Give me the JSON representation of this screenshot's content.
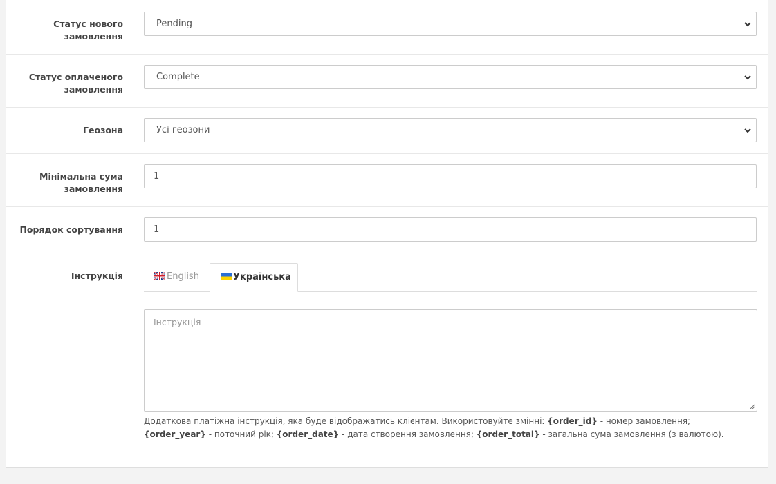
{
  "form": {
    "new_order_status": {
      "label_line1": "Статус нового",
      "label_line2": "замовлення",
      "selected": "Pending"
    },
    "paid_order_status": {
      "label_line1": "Статус оплаченого",
      "label_line2": "замовлення",
      "selected": "Complete"
    },
    "geo_zone": {
      "label": "Геозона",
      "selected": "Усі геозони"
    },
    "min_total": {
      "label_line1": "Мінімальна сума",
      "label_line2": "замовлення",
      "value": "1"
    },
    "sort_order": {
      "label": "Порядок сортування",
      "value": "1"
    },
    "instruction": {
      "label": "Інструкція",
      "tabs": [
        {
          "label": "English",
          "active": false
        },
        {
          "label": "Українська",
          "active": true
        }
      ],
      "placeholder": "Інструкція",
      "help": {
        "t1": "Додаткова платіжна інструкція, яка буде відображатись клієнтам. Використовуйте змінні: ",
        "v1": "{order_id}",
        "t2": " - номер замовлення; ",
        "v2": "{order_year}",
        "t3": " - поточний рік; ",
        "v3": "{order_date}",
        "t4": " - дата створення замовлення; ",
        "v4": "{order_total}",
        "t5": " - загальна сума замовлення (з валютою)."
      }
    }
  },
  "icons": {
    "select_arrow": "chevron-down-icon",
    "english_flag": "uk-flag-icon",
    "ukrainian_flag": "ukraine-flag-icon",
    "resize": "resize-grip-icon"
  },
  "colors": {
    "panel_bg": "#ffffff",
    "page_bg": "#f3f3f3",
    "border": "#cccccc",
    "flag_blue": "#2a6fd6",
    "flag_yellow": "#ffd500"
  }
}
